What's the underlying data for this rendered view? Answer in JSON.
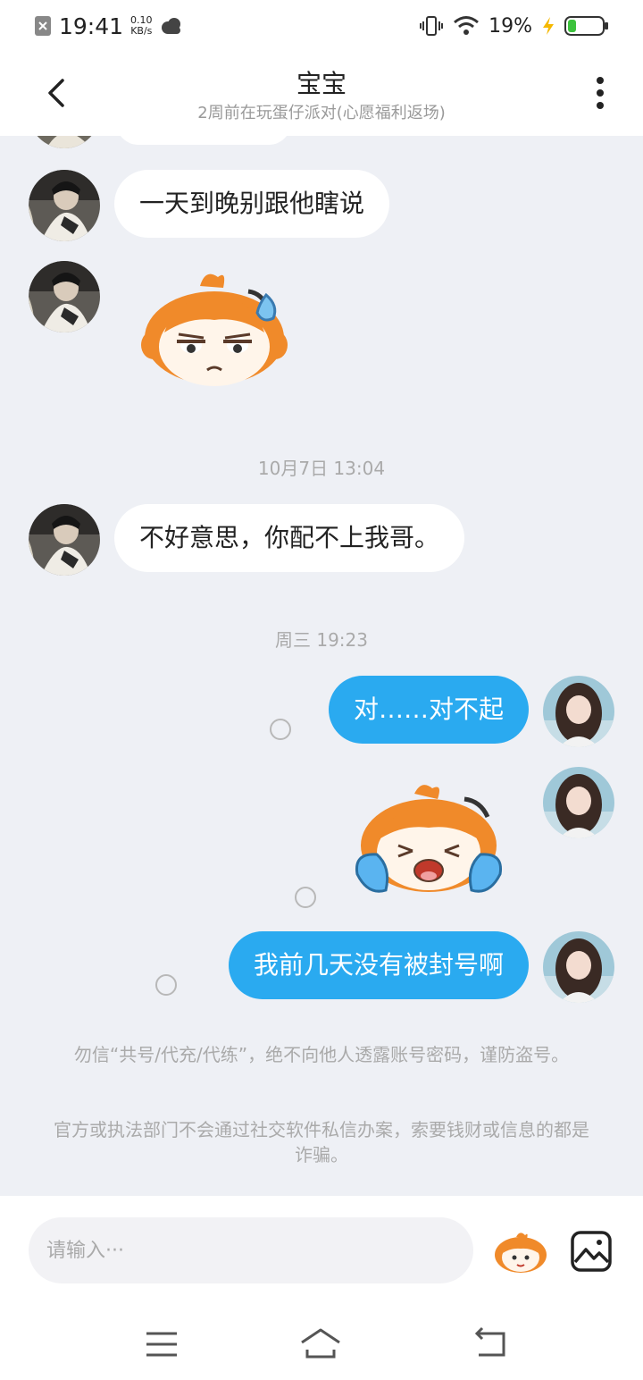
{
  "status_bar": {
    "time": "19:41",
    "speed_value": "0.10",
    "speed_unit": "KB/s",
    "battery_percent": "19%"
  },
  "header": {
    "title": "宝宝",
    "subtitle": "2周前在玩蛋仔派对(心愿福利返场)"
  },
  "messages": {
    "msg1": "一天到晚别跟他瞎说",
    "time1": "10月7日 13:04",
    "msg2": "不好意思，你配不上我哥。",
    "time2": "周三 19:23",
    "msg3": "对……对不起",
    "msg4": "我前几天没有被封号啊"
  },
  "notices": {
    "notice1": "勿信“共号/代充/代练”，绝不向他人透露账号密码，谨防盗号。",
    "notice2": "官方或执法部门不会通过社交软件私信办案，索要钱财或信息的都是诈骗。"
  },
  "input": {
    "placeholder": "请输入···"
  },
  "colors": {
    "accent": "#2aaaf0",
    "background": "#eef0f5",
    "sticker_orange": "#f08a2a",
    "sticker_blue": "#5ab4f0"
  },
  "icons": {
    "back": "back-arrow-icon",
    "more": "more-vertical-icon",
    "emoji": "eggy-emoji-icon",
    "image": "image-icon",
    "nav_menu": "menu-icon",
    "nav_home": "home-icon",
    "nav_back": "back-icon"
  }
}
